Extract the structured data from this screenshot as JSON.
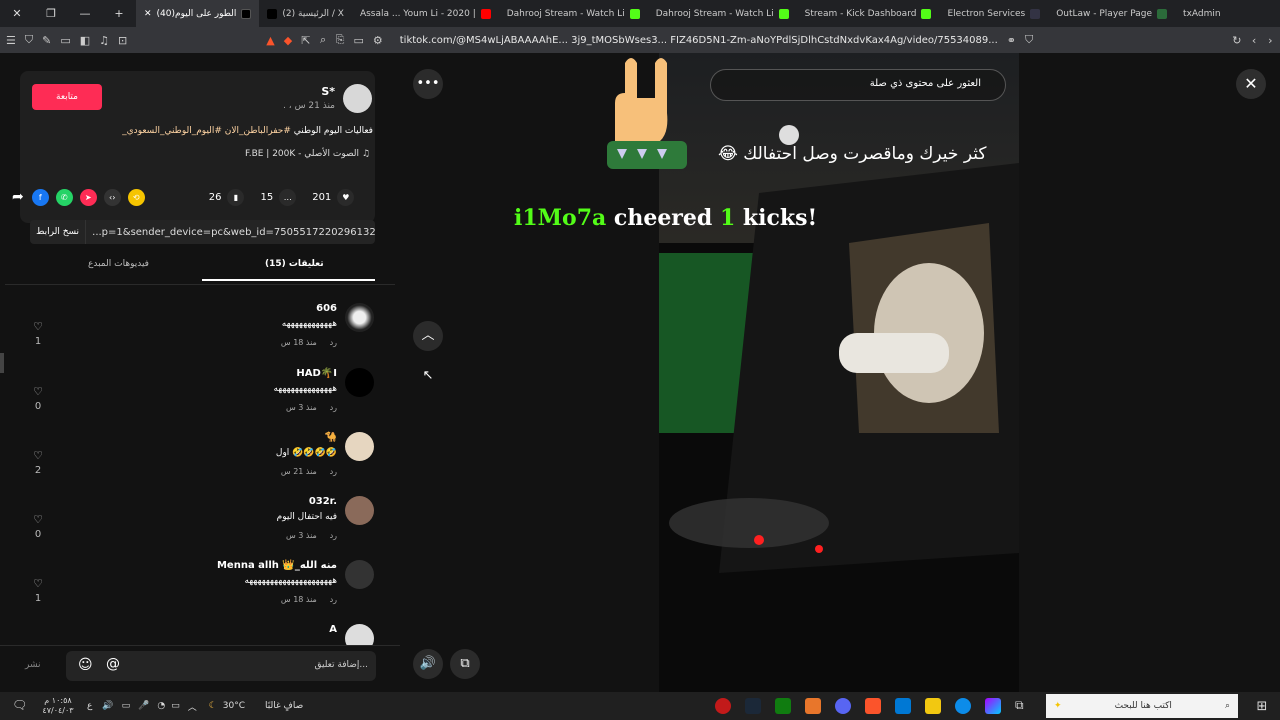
{
  "browser": {
    "tabs": [
      {
        "label": "(40)الطور على اليوم",
        "active": true
      },
      {
        "label": "(2) الرئيسية / X"
      },
      {
        "label": "Assala ... Youm Li - 2020 |"
      },
      {
        "label": "Dahrooj Stream - Watch Li"
      },
      {
        "label": "Dahrooj Stream - Watch Li"
      },
      {
        "label": "Stream - Kick Dashboard"
      },
      {
        "label": "Electron Services"
      },
      {
        "label": "OutLaw - Player Page"
      },
      {
        "label": "txAdmin"
      }
    ],
    "url": "tiktok.com/@MS4wLjABAAAAhE... 3j9_tMOSbWses3... FIZ46D5N1-Zm-aNoYPdlSjDlhCstdNxdvKax4Ag/video/75534089..."
  },
  "post": {
    "follow_label": "متابعة",
    "author": "S*",
    "time": ". ، منذ 21 س",
    "caption_plain": "فعاليات اليوم الوطني ",
    "caption_tags": "#حفرالباطن_الان #اليوم_الوطني_السعودي_",
    "sound": "F.BE | 200K - الصوت الأصلي",
    "likes": "201",
    "comments_count": "15",
    "saves": "26",
    "copy_label": "نسخ الرابط",
    "link": "...p=1&sender_device=pc&web_id=7505517220296132151"
  },
  "tabs": {
    "comments": "(15) تعليقات",
    "creator_videos": "فيديوهات المبدع"
  },
  "comments": [
    {
      "name": "606",
      "text": "ههههههههههههه",
      "time": "منذ 18 س",
      "reply": "رد",
      "likes": "1"
    },
    {
      "name": "HAD🌴I",
      "text": "ههههههههههههههه",
      "time": "منذ 3 س",
      "reply": "رد",
      "likes": "0"
    },
    {
      "name": "🐪",
      "text": "اول 🤣🤣🤣🤣",
      "time": "منذ 21 س",
      "reply": "رد",
      "likes": "2"
    },
    {
      "name": "032r.",
      "text": "فيه احتفال اليوم",
      "time": "منذ 3 س",
      "reply": "رد",
      "likes": "0"
    },
    {
      "name": "Menna allh 👑_منه الله",
      "text": "هههههههههههههههههههههه",
      "time": "منذ 18 س",
      "reply": "رد",
      "likes": "1"
    },
    {
      "name": "A",
      "text": "",
      "time": "",
      "reply": "",
      "likes": ""
    }
  ],
  "input": {
    "placeholder": "إضافة تعليق...",
    "post_label": "نشر"
  },
  "video": {
    "search_text": "العثور على محتوى ذي صلة",
    "overlay_ar": "كثر خيرك وماقصرت وصل احتفالك 😂",
    "cheer_user": "i1Mo7a",
    "cheer_mid": " cheered ",
    "cheer_count": "1",
    "cheer_end": " kicks!"
  },
  "taskbar": {
    "search_placeholder": "اكتب هنا للبحث",
    "weather": "30°C",
    "weather_text": "صافٍ غالبًا",
    "time": "١٠:٥٨ م",
    "date": "٤٧/٠٤/٠٣",
    "lang": "ع"
  },
  "colors": {
    "accent": "#fe2c55",
    "kick_green": "#53fc18"
  }
}
